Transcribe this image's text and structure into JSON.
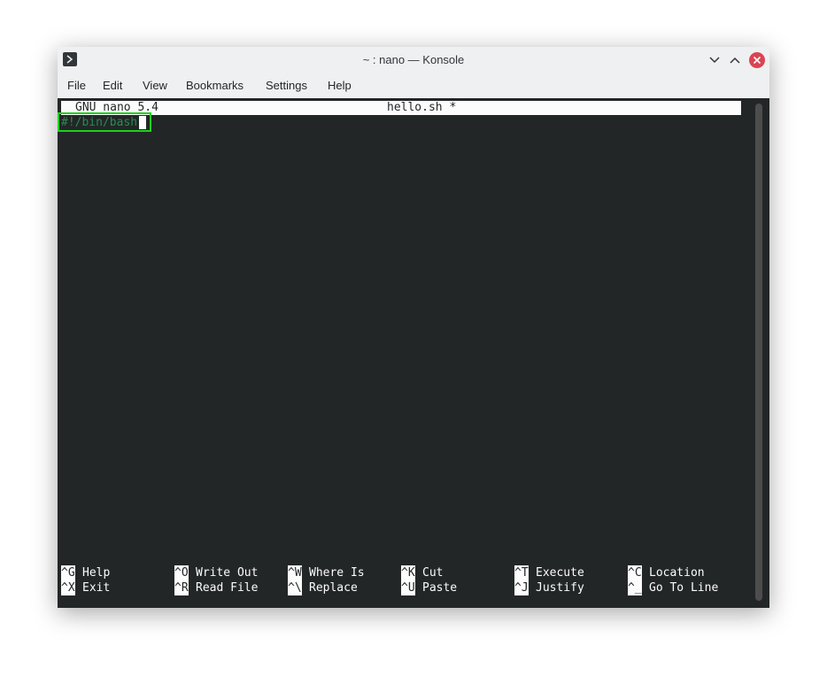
{
  "window": {
    "title": "~ : nano — Konsole"
  },
  "menu": {
    "items": [
      "File",
      "Edit",
      "View",
      "Bookmarks",
      "Settings",
      "Help"
    ]
  },
  "nano": {
    "version": "GNU nano 5.4",
    "filename": "hello.sh *",
    "lines": [
      "#!/bin/bash"
    ]
  },
  "shortcuts": {
    "row1": [
      {
        "key": "^G",
        "label": "Help"
      },
      {
        "key": "^O",
        "label": "Write Out"
      },
      {
        "key": "^W",
        "label": "Where Is"
      },
      {
        "key": "^K",
        "label": "Cut"
      },
      {
        "key": "^T",
        "label": "Execute"
      },
      {
        "key": "^C",
        "label": "Location"
      }
    ],
    "row2": [
      {
        "key": "^X",
        "label": "Exit"
      },
      {
        "key": "^R",
        "label": "Read File"
      },
      {
        "key": "^\\",
        "label": "Replace"
      },
      {
        "key": "^U",
        "label": "Paste"
      },
      {
        "key": "^J",
        "label": "Justify"
      },
      {
        "key": "^_",
        "label": "Go To Line"
      }
    ]
  },
  "colors": {
    "terminal_bg": "#232627",
    "text_highlight": "#1fd11f",
    "close_button": "#da4453"
  },
  "icons": {
    "app": "terminal-icon",
    "minimize": "chevron-down-icon",
    "maximize": "chevron-up-icon",
    "close": "close-icon"
  }
}
